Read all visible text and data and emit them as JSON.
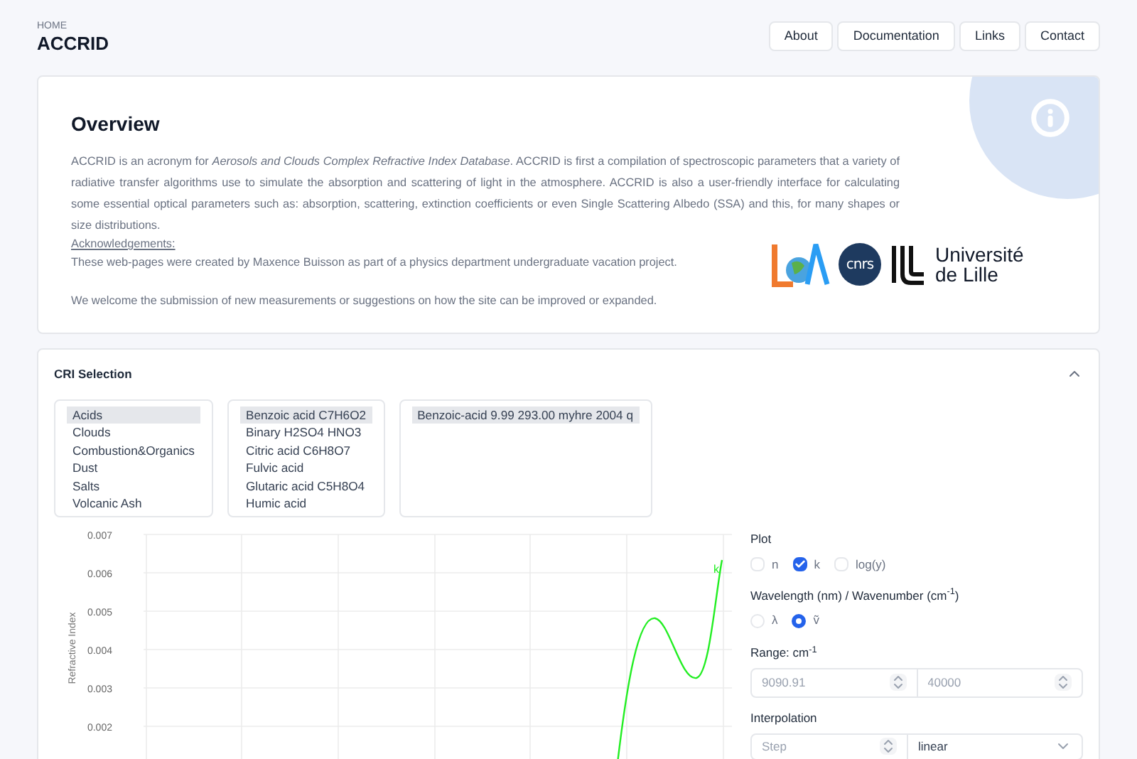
{
  "header": {
    "breadcrumb": "HOME",
    "title": "ACCRID"
  },
  "nav": [
    "About",
    "Documentation",
    "Links",
    "Contact"
  ],
  "overview": {
    "title": "Overview",
    "paragraph": "ACCRID is an acronym for *Aerosols and Clouds Complex Refractive Index Database*. ACCRID is first a compilation of spectroscopic parameters that a variety of radiative transfer algorithms use to simulate the absorption and scattering of light in the atmosphere. ACCRID is also a user-friendly interface for calculating some essential optical parameters such as: absorption, scattering, extinction coefficients or even Single Scattering Albedo (SSA) and this, for many shapes or size distributions.",
    "ack_heading": "Acknowledgements:",
    "ack_text": "These web-pages were created by Maxence Buisson as part of a physics department undergraduate vacation project.",
    "welcome": "We welcome the submission of new measurements or suggestions on how the site can be improved or expanded.",
    "logos": {
      "cnrs": "cnrs",
      "university": "Université de Lille"
    }
  },
  "cri": {
    "title": "CRI Selection",
    "expanded": true,
    "categories": [
      {
        "label": "Acids",
        "selected": true
      },
      {
        "label": "Clouds",
        "selected": false
      },
      {
        "label": "Combustion&Organics",
        "selected": false
      },
      {
        "label": "Dust",
        "selected": false
      },
      {
        "label": "Salts",
        "selected": false
      },
      {
        "label": "Volcanic Ash",
        "selected": false
      }
    ],
    "substances": [
      {
        "label": "Benzoic acid C7H6O2",
        "selected": true
      },
      {
        "label": "Binary H2SO4 HNO3",
        "selected": false
      },
      {
        "label": "Citric acid C6H8O7",
        "selected": false
      },
      {
        "label": "Fulvic acid",
        "selected": false
      },
      {
        "label": "Glutaric acid C5H8O4",
        "selected": false
      },
      {
        "label": "Humic acid",
        "selected": false
      }
    ],
    "datasets": [
      {
        "label": "Benzoic-acid 9.99 293.00 myhre 2004 q",
        "selected": true
      }
    ]
  },
  "chart": {
    "ylabel": "Refractive Index",
    "yticks": [
      "0.007",
      "0.006",
      "0.005",
      "0.004",
      "0.003",
      "0.002"
    ],
    "series_label": "k"
  },
  "controls": {
    "plot_label": "Plot",
    "plot_options": [
      {
        "label": "n",
        "checked": false
      },
      {
        "label": "k",
        "checked": true
      },
      {
        "label": "log(y)",
        "checked": false
      }
    ],
    "unit_label": "Wavelength (nm) / Wavenumber (cm$^{-1}$)",
    "unit_options": [
      {
        "label": "λ",
        "selected": false
      },
      {
        "label": "ṽ",
        "selected": true
      }
    ],
    "range_label": "Range: cm$^{-1}$",
    "range_min": {
      "placeholder": "9090.91"
    },
    "range_max": {
      "placeholder": "40000"
    },
    "interp_label": "Interpolation",
    "step": {
      "placeholder": "Step"
    },
    "method": "linear"
  }
}
